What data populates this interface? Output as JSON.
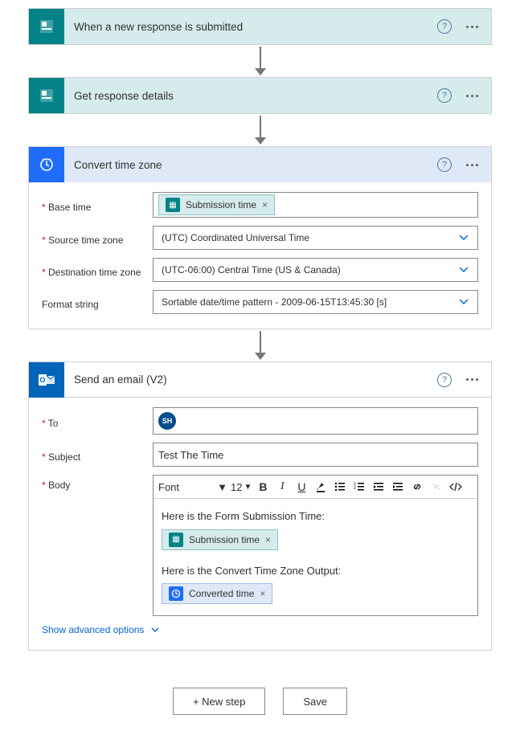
{
  "steps": {
    "s1_title": "When a new response is submitted",
    "s2_title": "Get response details",
    "s3_title": "Convert time zone",
    "s4_title": "Send an email (V2)"
  },
  "convert": {
    "label_base": "Base time",
    "label_src": "Source time zone",
    "label_dst": "Destination time zone",
    "label_fmt": "Format string",
    "token_submission": "Submission time",
    "val_src": "(UTC) Coordinated Universal Time",
    "val_dst": "(UTC-06:00) Central Time (US & Canada)",
    "val_fmt": "Sortable date/time pattern - 2009-06-15T13:45:30 [s]"
  },
  "email": {
    "label_to": "To",
    "label_subj": "Subject",
    "label_body": "Body",
    "avatar": "SH",
    "subject_value": "Test The Time",
    "font_label": "Font",
    "font_size": "12",
    "body_line1": "Here is the Form Submission Time:",
    "body_line2": "Here is the Convert Time Zone Output:",
    "token_submission": "Submission time",
    "token_converted": "Converted time",
    "adv_options": "Show advanced options"
  },
  "footer": {
    "new_step": "+ New step",
    "save": "Save"
  }
}
